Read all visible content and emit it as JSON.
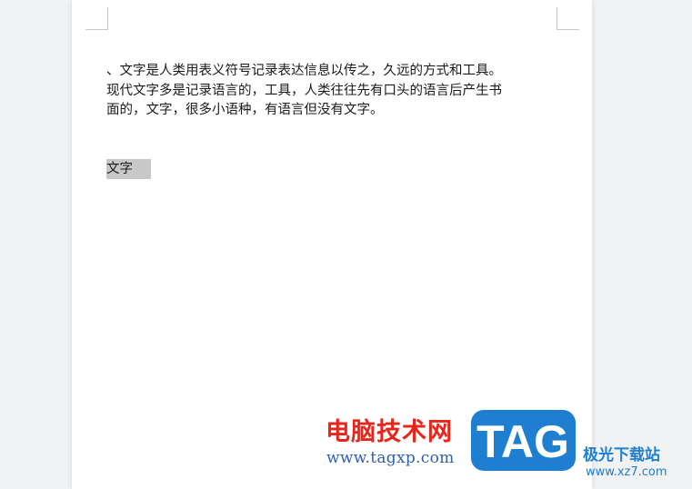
{
  "document": {
    "paragraph_lines": [
      "、文字是人类用表义符号记录表达信息以传之，久远的方式和工具。",
      "现代文字多是记录语言的，工具，人类往往先有口头的语言后产生书",
      "面的，文字，很多小语种，有语言但没有文字。"
    ],
    "selected_text": "文字"
  },
  "watermark": {
    "site_name": "电脑技术网",
    "site_url": "www.tagxp.com",
    "logo_text": "TAG",
    "secondary_name": "极光下载站",
    "secondary_url": "www.xz7.com",
    "colors": {
      "red": "#e8251b",
      "blue": "#2c5fb2",
      "logo_blue": "#1e7ed0"
    }
  }
}
